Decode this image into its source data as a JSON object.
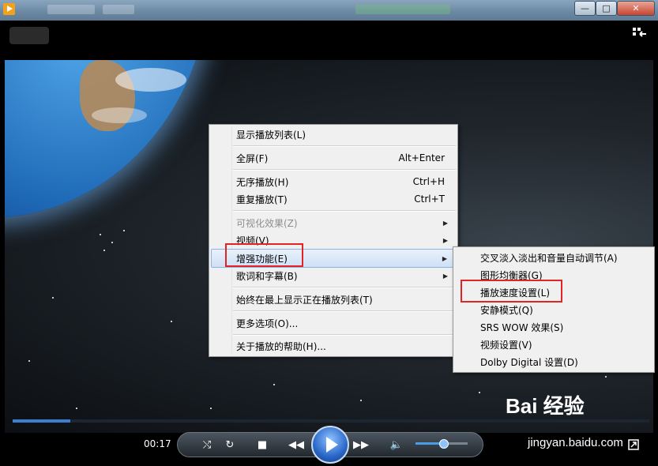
{
  "menu": {
    "items": [
      {
        "label": "显示播放列表(L)",
        "shortcut": "",
        "submenu": false,
        "disabled": false
      },
      {
        "label": "全屏(F)",
        "shortcut": "Alt+Enter",
        "submenu": false,
        "disabled": false
      },
      {
        "label": "无序播放(H)",
        "shortcut": "Ctrl+H",
        "submenu": false,
        "disabled": false
      },
      {
        "label": "重复播放(T)",
        "shortcut": "Ctrl+T",
        "submenu": false,
        "disabled": false
      },
      {
        "label": "可视化效果(Z)",
        "shortcut": "",
        "submenu": true,
        "disabled": true
      },
      {
        "label": "视频(V)",
        "shortcut": "",
        "submenu": true,
        "disabled": false
      },
      {
        "label": "增强功能(E)",
        "shortcut": "",
        "submenu": true,
        "disabled": false,
        "highlighted": true
      },
      {
        "label": "歌词和字幕(B)",
        "shortcut": "",
        "submenu": true,
        "disabled": false
      },
      {
        "label": "始终在最上显示正在播放列表(T)",
        "shortcut": "",
        "submenu": false,
        "disabled": false
      },
      {
        "label": "更多选项(O)...",
        "shortcut": "",
        "submenu": false,
        "disabled": false
      },
      {
        "label": "关于播放的帮助(H)...",
        "shortcut": "",
        "submenu": false,
        "disabled": false
      }
    ]
  },
  "submenu": {
    "items": [
      {
        "label": "交叉淡入淡出和音量自动调节(A)"
      },
      {
        "label": "图形均衡器(G)"
      },
      {
        "label": "播放速度设置(L)",
        "highlighted": true
      },
      {
        "label": "安静模式(Q)"
      },
      {
        "label": "SRS WOW 效果(S)"
      },
      {
        "label": "视频设置(V)"
      },
      {
        "label": "Dolby Digital 设置(D)"
      }
    ]
  },
  "player": {
    "time": "00:17",
    "seek_progress": 0.09,
    "volume": 0.55
  },
  "icons": {
    "shuffle": "shuffle-icon",
    "repeat": "repeat-icon",
    "stop": "stop-icon",
    "previous": "previous-icon",
    "play": "play-icon",
    "next": "next-icon",
    "volume": "volume-icon",
    "switch_to_library": "switch-to-library-icon",
    "compact_mode": "compact-mode-icon"
  },
  "watermark": {
    "brand": "Bai 经验",
    "url": "jingyan.baidu.com"
  },
  "colors": {
    "menu_bg": "#f0f0f0",
    "highlight_border": "#e12424",
    "accent": "#3c7fd0"
  }
}
